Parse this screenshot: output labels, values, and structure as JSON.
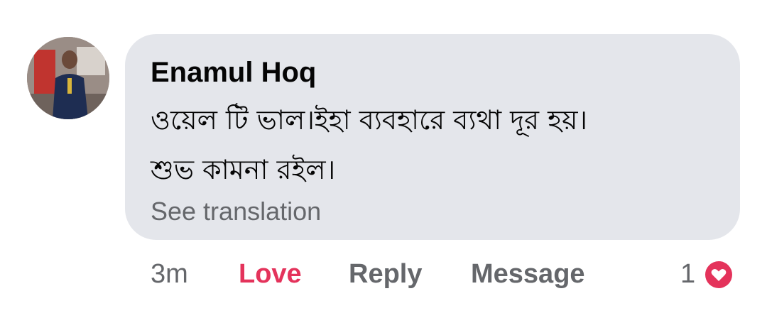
{
  "comment": {
    "author": "Enamul Hoq",
    "text": "ওয়েল টি ভাল।ইহা ব্যবহারে ব্যথা  দূর হয়।\nশুভ কামনা রইল।",
    "see_translation": "See translation"
  },
  "actions": {
    "time": "3m",
    "love": "Love",
    "reply": "Reply",
    "message": "Message"
  },
  "reactions": {
    "count": "1",
    "icon": "heart-icon",
    "color": "#e4335b"
  },
  "colors": {
    "bubble": "#e4e6eb",
    "secondary_text": "#65676b",
    "primary_text": "#050505",
    "love_active": "#e4335b"
  }
}
